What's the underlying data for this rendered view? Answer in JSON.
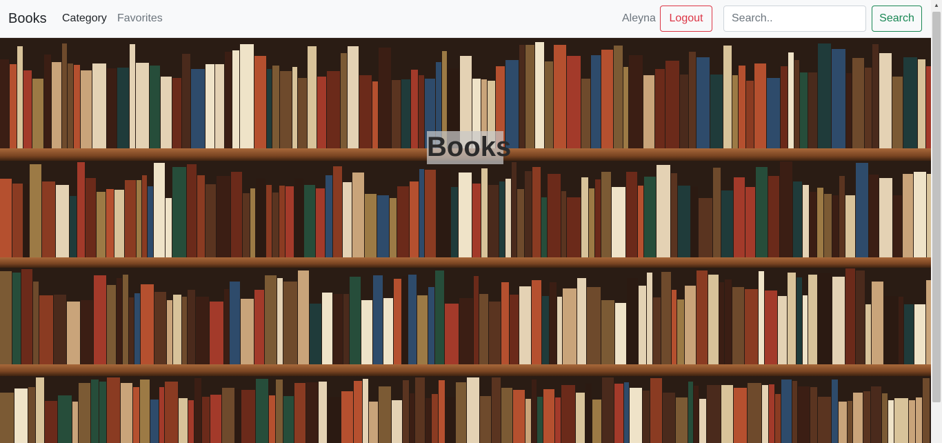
{
  "navbar": {
    "brand": "Books",
    "links": [
      "Category",
      "Favorites"
    ],
    "username": "Aleyna",
    "logout_label": "Logout",
    "search_placeholder": "Search..",
    "search_label": "Search"
  },
  "hero": {
    "title": "Books",
    "background_image": "bookshelf"
  },
  "colors": {
    "danger": "#dc3545",
    "success": "#198754",
    "navbar_bg": "#f8f9fa"
  }
}
